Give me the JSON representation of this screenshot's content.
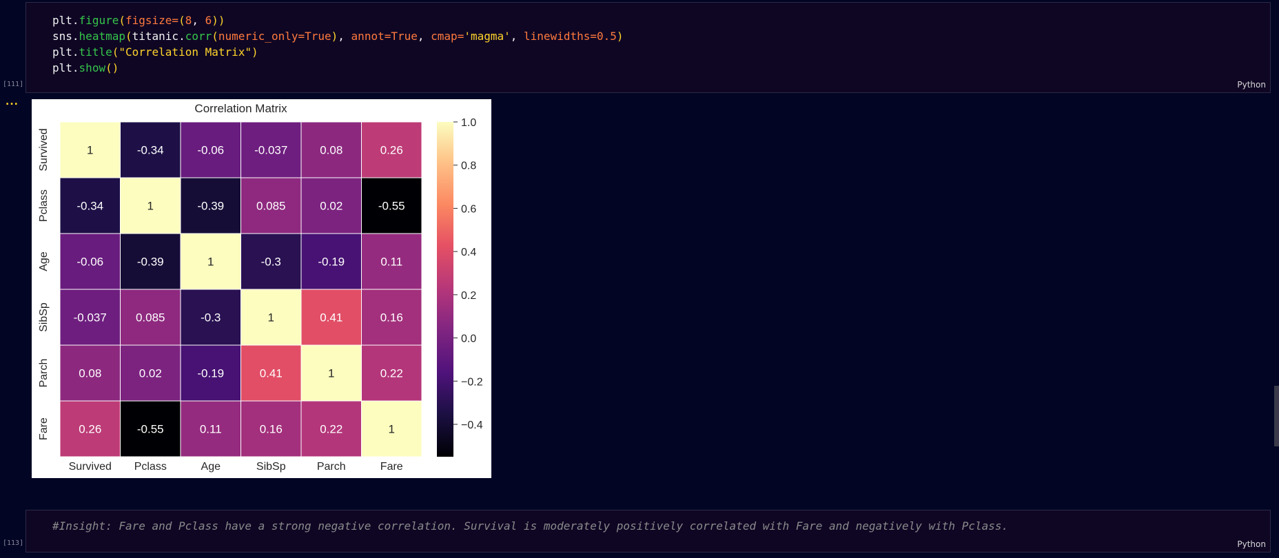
{
  "cell1": {
    "exec_count": "[111]",
    "lang": "Python",
    "lines": [
      [
        [
          "plt",
          "var"
        ],
        [
          ".",
          "var"
        ],
        [
          "figure",
          "fn"
        ],
        [
          "(",
          "paren"
        ],
        [
          "figsize",
          "param"
        ],
        [
          "=",
          "op"
        ],
        [
          "(",
          "paren"
        ],
        [
          "8",
          "num"
        ],
        [
          ", ",
          "var"
        ],
        [
          "6",
          "num"
        ],
        [
          ")",
          "paren"
        ],
        [
          ")",
          "paren"
        ]
      ],
      [
        [
          "sns",
          "var"
        ],
        [
          ".",
          "var"
        ],
        [
          "heatmap",
          "fn"
        ],
        [
          "(",
          "paren"
        ],
        [
          "titanic",
          "var"
        ],
        [
          ".",
          "var"
        ],
        [
          "corr",
          "fn"
        ],
        [
          "(",
          "paren"
        ],
        [
          "numeric_only",
          "param"
        ],
        [
          "=",
          "op"
        ],
        [
          "True",
          "kw"
        ],
        [
          ")",
          "paren"
        ],
        [
          ", ",
          "var"
        ],
        [
          "annot",
          "param"
        ],
        [
          "=",
          "op"
        ],
        [
          "True",
          "kw"
        ],
        [
          ", ",
          "var"
        ],
        [
          "cmap",
          "param"
        ],
        [
          "=",
          "op"
        ],
        [
          "'magma'",
          "str"
        ],
        [
          ", ",
          "var"
        ],
        [
          "linewidths",
          "param"
        ],
        [
          "=",
          "op"
        ],
        [
          "0.5",
          "num"
        ],
        [
          ")",
          "paren"
        ]
      ],
      [
        [
          "plt",
          "var"
        ],
        [
          ".",
          "var"
        ],
        [
          "title",
          "fn"
        ],
        [
          "(",
          "paren"
        ],
        [
          "\"Correlation Matrix\"",
          "str"
        ],
        [
          ")",
          "paren"
        ]
      ],
      [
        [
          "plt",
          "var"
        ],
        [
          ".",
          "var"
        ],
        [
          "show",
          "fn"
        ],
        [
          "()",
          "paren"
        ]
      ]
    ]
  },
  "output": {
    "ellipsis": "..."
  },
  "cell2": {
    "exec_count": "[113]",
    "lang": "Python",
    "comment": "#Insight: Fare and Pclass have a strong negative correlation. Survival is moderately positively correlated with Fare and negatively with Pclass."
  },
  "colors": {
    "background": "#020524",
    "cell_bg": "#0f0624",
    "cell_border": "#2b2a45",
    "function": "#35c64a",
    "parameter": "#ff7a3d",
    "string": "#ffd42a",
    "comment": "#8a8a8a"
  },
  "chart_data": {
    "type": "heatmap",
    "title": "Correlation Matrix",
    "colormap": "magma",
    "labels": [
      "Survived",
      "Pclass",
      "Age",
      "SibSp",
      "Parch",
      "Fare"
    ],
    "annotations": [
      [
        "1",
        "-0.34",
        "-0.06",
        "-0.037",
        "0.08",
        "0.26"
      ],
      [
        "-0.34",
        "1",
        "-0.39",
        "0.085",
        "0.02",
        "-0.55"
      ],
      [
        "-0.06",
        "-0.39",
        "1",
        "-0.3",
        "-0.19",
        "0.11"
      ],
      [
        "-0.037",
        "0.085",
        "-0.3",
        "1",
        "0.41",
        "0.16"
      ],
      [
        "0.08",
        "0.02",
        "-0.19",
        "0.41",
        "1",
        "0.22"
      ],
      [
        "0.26",
        "-0.55",
        "0.11",
        "0.16",
        "0.22",
        "1"
      ]
    ],
    "vmin": -0.55,
    "vmax": 1.0,
    "colorbar_ticks": [
      "1.0",
      "0.8",
      "0.6",
      "0.4",
      "0.2",
      "0.0",
      "−0.2",
      "−0.4"
    ],
    "colorbar_tick_values": [
      1.0,
      0.8,
      0.6,
      0.4,
      0.2,
      0.0,
      -0.2,
      -0.4
    ]
  }
}
